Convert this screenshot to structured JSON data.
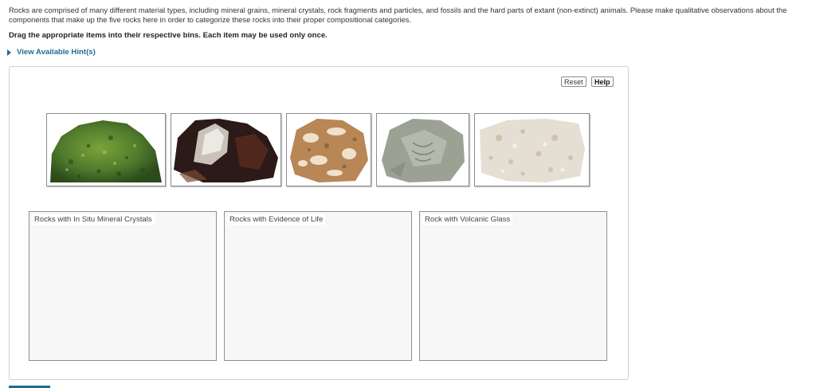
{
  "intro": {
    "text": "Rocks are comprised of many different material types, including mineral grains, mineral crystals, rock fragments and particles, and fossils and the hard parts of extant (non-extinct) animals. Please make qualitative observations about the components that make up the five rocks here in order to categorize these rocks into their proper compositional categories."
  },
  "instruction": "Drag the appropriate items into their respective bins. Each item may be used only once.",
  "hint_label": "View Available Hint(s)",
  "buttons": {
    "reset": "Reset",
    "help": "Help"
  },
  "rocks": [
    {
      "id": "rock-1",
      "description": "green crystalline rock",
      "color": "#4f7a2c"
    },
    {
      "id": "rock-2",
      "description": "dark glassy rock",
      "color": "#3a2520"
    },
    {
      "id": "rock-3",
      "description": "shell fragment rock",
      "color": "#c99a6b"
    },
    {
      "id": "rock-4",
      "description": "gray rock with fossil impression",
      "color": "#9ba294"
    },
    {
      "id": "rock-5",
      "description": "white granular rock",
      "color": "#ddd6cb"
    }
  ],
  "bins": [
    {
      "label": "Rocks with In Situ Mineral Crystals"
    },
    {
      "label": "Rocks with Evidence of Life"
    },
    {
      "label": "Rock with Volcanic Glass"
    }
  ]
}
